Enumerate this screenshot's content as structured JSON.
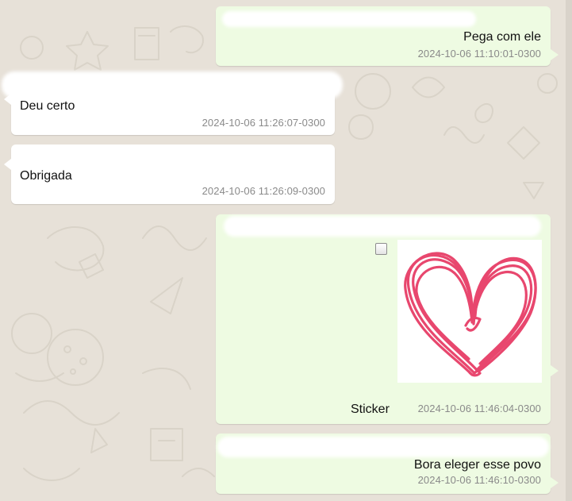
{
  "messages": [
    {
      "direction": "outgoing",
      "text": "Pega com ele",
      "time": "2024-10-06 11:10:01-0300"
    },
    {
      "direction": "incoming",
      "text": "Deu certo",
      "time": "2024-10-06 11:26:07-0300"
    },
    {
      "direction": "incoming",
      "text": "Obrigada",
      "time": "2024-10-06 11:26:09-0300"
    },
    {
      "direction": "outgoing",
      "text": "Sticker",
      "time": "2024-10-06 11:46:04-0300",
      "attachment": "heart-sticker"
    },
    {
      "direction": "outgoing",
      "text": "Bora eleger esse povo",
      "time": "2024-10-06 11:46:10-0300"
    }
  ],
  "colors": {
    "outgoing_bubble": "#eefbe2",
    "incoming_bubble": "#ffffff",
    "chat_background": "#e7e1d8",
    "timestamp": "#8a8a8a",
    "sticker_heart": "#e8476e"
  }
}
